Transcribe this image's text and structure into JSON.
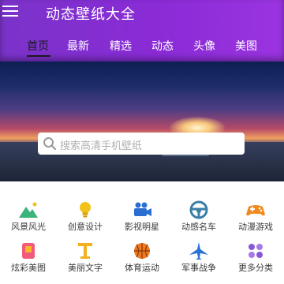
{
  "app": {
    "title": "动态壁纸大全"
  },
  "tabs": [
    {
      "label": "首页",
      "active": true
    },
    {
      "label": "最新"
    },
    {
      "label": "精选"
    },
    {
      "label": "动态"
    },
    {
      "label": "头像"
    },
    {
      "label": "美图"
    }
  ],
  "search": {
    "placeholder": "搜索高清手机壁纸"
  },
  "categories": [
    {
      "label": "风景风光",
      "icon": "landscape-icon",
      "color": "#3bb37a"
    },
    {
      "label": "创意设计",
      "icon": "lightbulb-icon",
      "color": "#f2c21b"
    },
    {
      "label": "影视明星",
      "icon": "camera-icon",
      "color": "#2a6ed1"
    },
    {
      "label": "动感名车",
      "icon": "steering-wheel-icon",
      "color": "#3a7fa8"
    },
    {
      "label": "动漫游戏",
      "icon": "gamepad-icon",
      "color": "#f28a1e"
    },
    {
      "label": "炫彩美图",
      "icon": "palette-icon",
      "color": "#f15a7a"
    },
    {
      "label": "美丽文字",
      "icon": "text-icon",
      "color": "#f2b01e"
    },
    {
      "label": "体育运动",
      "icon": "basketball-icon",
      "color": "#f07a1e"
    },
    {
      "label": "军事战争",
      "icon": "jet-icon",
      "color": "#2a72d6"
    },
    {
      "label": "更多分类",
      "icon": "more-icon",
      "color": "#8a56d8"
    }
  ]
}
